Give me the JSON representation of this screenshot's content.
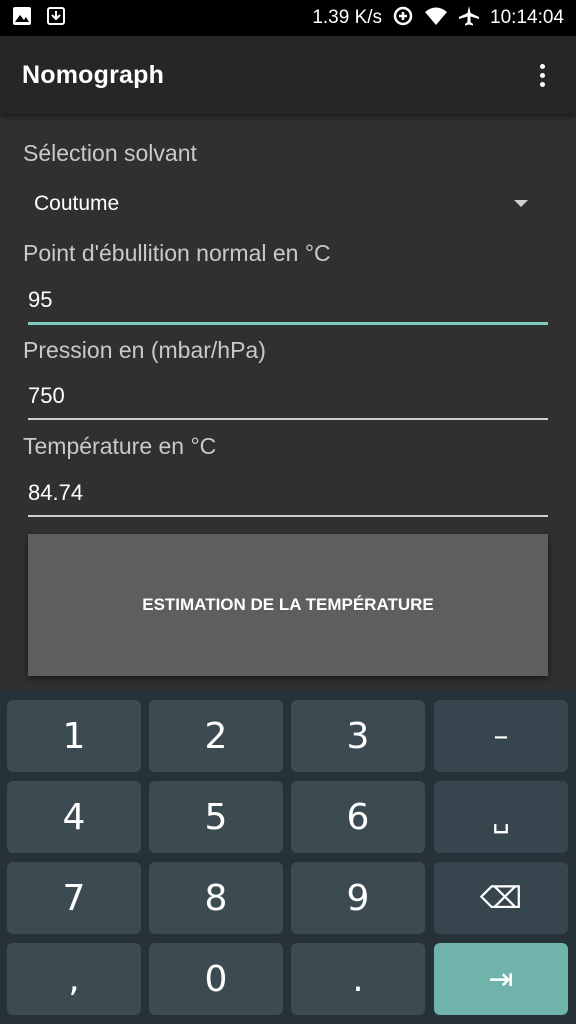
{
  "status_bar": {
    "speed": "1.39 K/s",
    "time": "10:14:04"
  },
  "app_bar": {
    "title": "Nomograph"
  },
  "form": {
    "solvent_label": "Sélection solvant",
    "solvent_value": "Coutume",
    "boiling_point_label": "Point d'ébullition normal en °C",
    "boiling_point_value": "95",
    "pressure_label": "Pression en (mbar/hPa)",
    "pressure_value": "750",
    "temperature_label": "Température en °C",
    "temperature_value": "84.74",
    "estimate_button": "ESTIMATION DE LA TEMPÉRATURE"
  },
  "keyboard": {
    "keys": [
      "1",
      "2",
      "3",
      "–",
      "4",
      "5",
      "6",
      "␣",
      "7",
      "8",
      "9",
      "⌫",
      ",",
      "0",
      ".",
      "⇥"
    ]
  },
  "colors": {
    "accent": "#80cbc4",
    "enter_key": "#6fb3ab"
  }
}
